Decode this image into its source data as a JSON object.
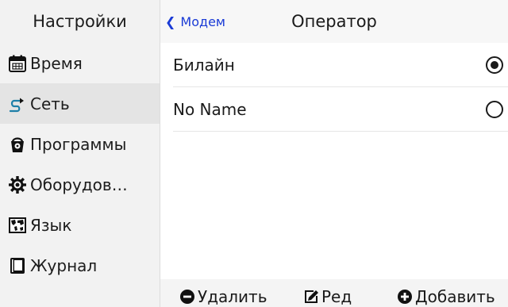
{
  "sidebar": {
    "title": "Настройки",
    "items": [
      {
        "label": "Время",
        "icon": "calendar-icon",
        "active": false
      },
      {
        "label": "Сеть",
        "icon": "network-icon",
        "active": true
      },
      {
        "label": "Программы",
        "icon": "package-icon",
        "active": false
      },
      {
        "label": "Оборудов…",
        "icon": "gear-icon",
        "active": false
      },
      {
        "label": "Язык",
        "icon": "map-icon",
        "active": false
      },
      {
        "label": "Журнал",
        "icon": "book-icon",
        "active": false
      }
    ]
  },
  "header": {
    "back_label": "Модем",
    "title": "Оператор",
    "accent_color": "#1a3bd6"
  },
  "operators": [
    {
      "name": "Билайн",
      "selected": true
    },
    {
      "name": "No Name",
      "selected": false
    }
  ],
  "toolbar": {
    "delete_label": "Удалить",
    "edit_label": "Ред",
    "add_label": "Добавить"
  }
}
